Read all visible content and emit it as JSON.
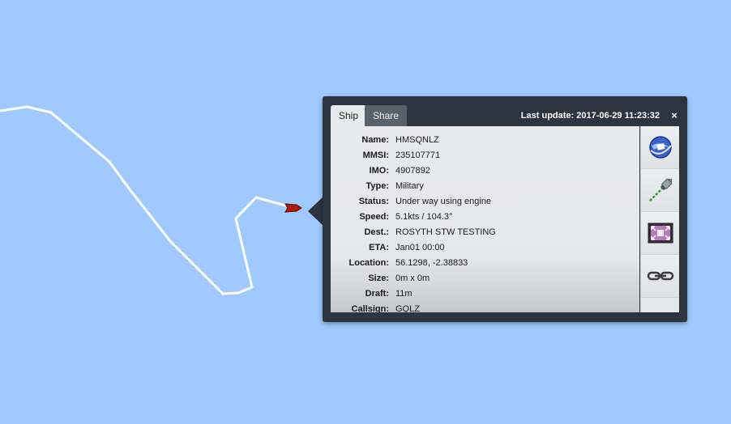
{
  "tabs": {
    "ship": "Ship",
    "share": "Share"
  },
  "last_update": "Last update: 2017-06-29 11:23:32",
  "close_label": "×",
  "fields": [
    {
      "label": "Name:",
      "value": "HMSQNLZ"
    },
    {
      "label": "MMSI:",
      "value": "235107771"
    },
    {
      "label": "IMO:",
      "value": "4907892"
    },
    {
      "label": "Type:",
      "value": "Military"
    },
    {
      "label": "Status:",
      "value": "Under way using engine"
    },
    {
      "label": "Speed:",
      "value": "5.1kts / 104.3°"
    },
    {
      "label": "Dest.:",
      "value": "ROSYTH STW TESTING"
    },
    {
      "label": "ETA:",
      "value": "Jan01 00:00"
    },
    {
      "label": "Location:",
      "value": "56.1298, -2.38833"
    },
    {
      "label": "Size:",
      "value": "0m x 0m"
    },
    {
      "label": "Draft:",
      "value": "11m"
    },
    {
      "label": "Callsign:",
      "value": "GQLZ"
    }
  ],
  "side_buttons": [
    "google-earth-icon",
    "rocket-track-icon",
    "fullscreen-photo-icon",
    "link-icon"
  ],
  "colors": {
    "sea": "#a0caff",
    "track": "#ffffff",
    "vessel": "#c21a0c",
    "popup": "#2c3440"
  }
}
